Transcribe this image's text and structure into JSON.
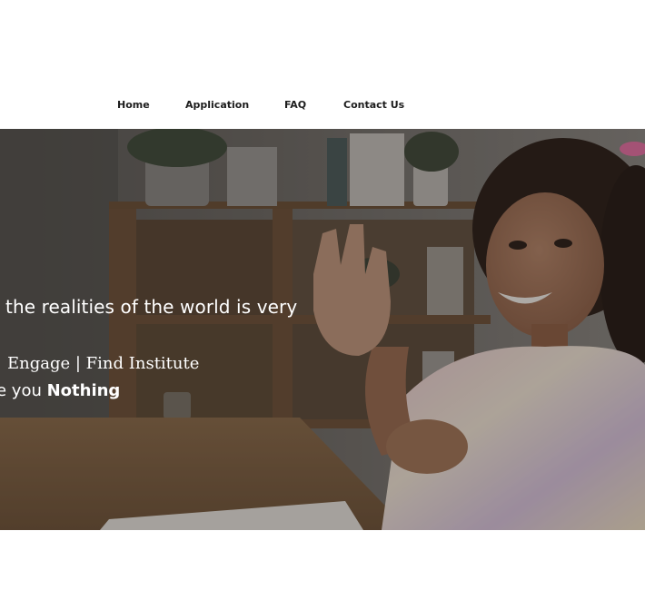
{
  "nav": {
    "items": [
      {
        "label": "Home"
      },
      {
        "label": "Application"
      },
      {
        "label": "FAQ"
      },
      {
        "label": "Contact Us"
      }
    ]
  },
  "hero": {
    "headline": "the realities of the world is very",
    "tagline": "Engage | Find Institute",
    "subline_prefix": "e you ",
    "subline_bold": "Nothing"
  },
  "colors": {
    "nav_text": "#1d1d1d",
    "hero_text": "#ffffff",
    "background": "#ffffff"
  }
}
